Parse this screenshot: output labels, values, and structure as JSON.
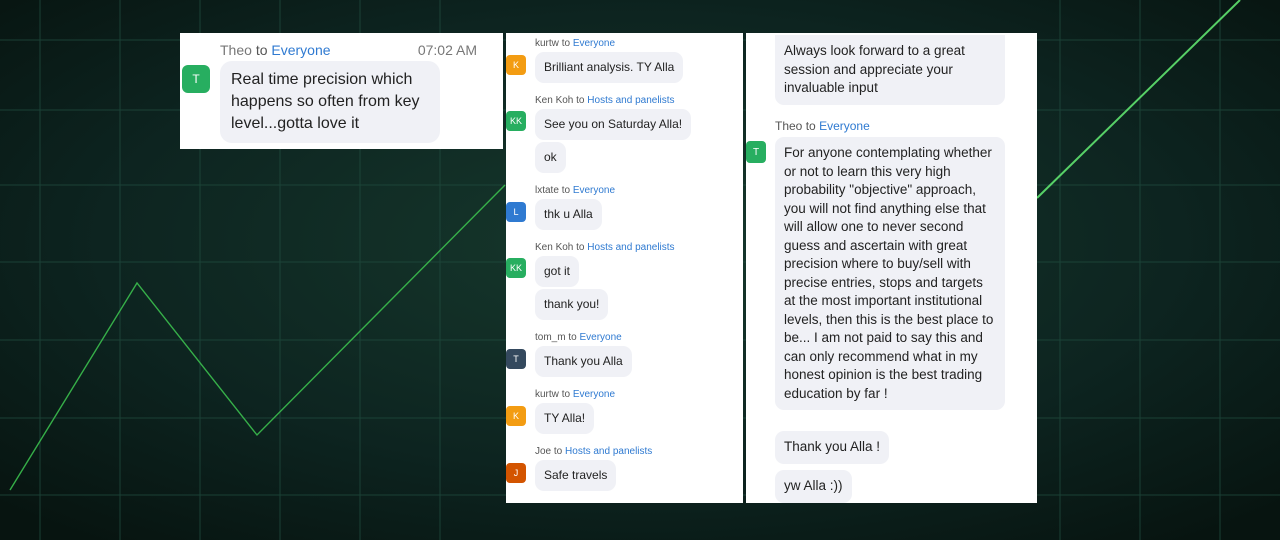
{
  "colors": {
    "accent": "#2f7ad1",
    "bubble_bg": "#f0f1f6",
    "avatar_green": "#27ae60",
    "avatar_orange": "#f39c12",
    "avatar_blue": "#2f7ad1",
    "avatar_dark": "#34495e",
    "avatar_red": "#d35400"
  },
  "panel1": {
    "sender": "Theo",
    "to_word": "to",
    "target": "Everyone",
    "time": "07:02 AM",
    "avatar": "T",
    "text": "Real time precision which happens so often from key level...gotta love it"
  },
  "panel2": {
    "groups": [
      {
        "sender": "kurtw",
        "to_word": "to",
        "target": "Everyone",
        "avatar": "K",
        "avatar_color": "orange",
        "messages": [
          "Brilliant analysis. TY Alla"
        ]
      },
      {
        "sender": "Ken Koh",
        "to_word": "to",
        "target": "Hosts and panelists",
        "avatar": "KK",
        "avatar_color": "green",
        "messages": [
          "See you on Saturday Alla!",
          "ok"
        ]
      },
      {
        "sender": "lxtate",
        "to_word": "to",
        "target": "Everyone",
        "avatar": "L",
        "avatar_color": "blue",
        "messages": [
          "thk u Alla"
        ]
      },
      {
        "sender": "Ken Koh",
        "to_word": "to",
        "target": "Hosts and panelists",
        "avatar": "KK",
        "avatar_color": "green",
        "messages": [
          "got it",
          "thank you!"
        ]
      },
      {
        "sender": "tom_m",
        "to_word": "to",
        "target": "Everyone",
        "avatar": "T",
        "avatar_color": "dark",
        "messages": [
          "Thank you Alla"
        ]
      },
      {
        "sender": "kurtw",
        "to_word": "to",
        "target": "Everyone",
        "avatar": "K",
        "avatar_color": "orange",
        "messages": [
          "TY Alla!"
        ]
      },
      {
        "sender": "Joe",
        "to_word": "to",
        "target": "Hosts and panelists",
        "avatar": "J",
        "avatar_color": "red",
        "messages": [
          "Safe travels"
        ]
      }
    ]
  },
  "panel3": {
    "top_message": "Always look forward to a great session and appreciate your invaluable input",
    "sender": "Theo",
    "to_word": "to",
    "target": "Everyone",
    "avatar": "T",
    "long_message": "For anyone contemplating whether or not to learn this very high probability \"objective\" approach, you will not find anything else that will allow one to never second guess and ascertain with great precision where to buy/sell with precise entries, stops and targets at the most important institutional levels, then this is the best place to be... I am not paid to say this and can only recommend what in my honest opinion is the best trading education by far !",
    "msg2": "Thank you Alla !",
    "msg3": "yw Alla :))"
  }
}
